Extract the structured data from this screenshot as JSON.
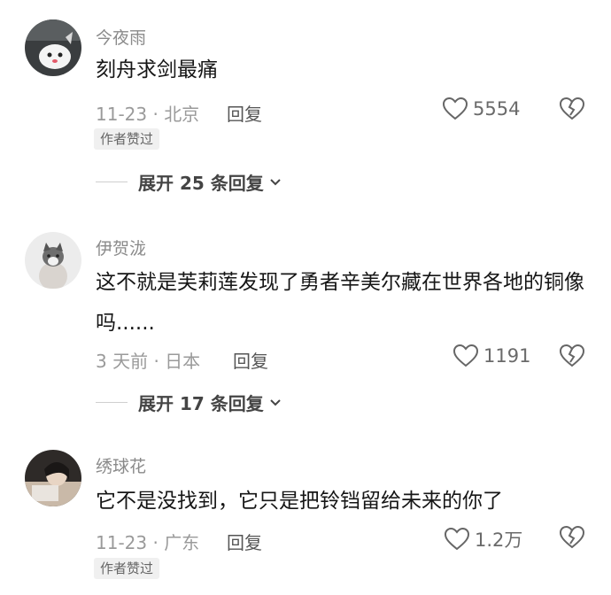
{
  "comments": [
    {
      "username": "今夜雨",
      "text": "刻舟求剑最痛",
      "meta": "11-23 · 北京",
      "reply": "回复",
      "likes": "5554",
      "badge": "作者赞过",
      "expand": "展开 25 条回复"
    },
    {
      "username": "伊贺泷",
      "text": "这不就是芙莉莲发现了勇者辛美尔藏在世界各地的铜像吗......",
      "meta": "3 天前 · 日本",
      "reply": "回复",
      "likes": "1191",
      "expand": "展开 17 条回复"
    },
    {
      "username": "绣球花",
      "text": "它不是没找到，它只是把铃铛留给未来的你了",
      "meta": "11-23 · 广东",
      "reply": "回复",
      "likes": "1.2万",
      "badge": "作者赞过"
    }
  ]
}
